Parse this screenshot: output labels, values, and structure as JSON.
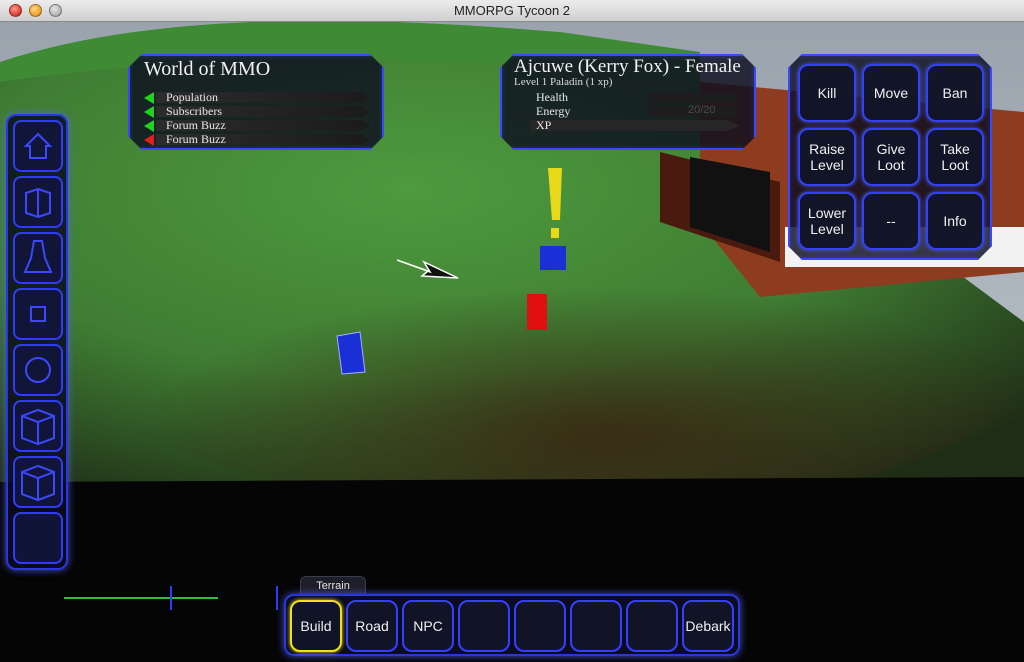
{
  "window": {
    "title": "MMORPG Tycoon 2"
  },
  "world_panel": {
    "title": "World of MMO",
    "stats": [
      {
        "label": "Population",
        "trend": "up",
        "color": "#1fd41f"
      },
      {
        "label": "Subscribers",
        "trend": "up",
        "color": "#1fd41f"
      },
      {
        "label": "Forum Buzz",
        "trend": "up",
        "color": "#1fd41f"
      },
      {
        "label": "Forum Buzz",
        "trend": "down",
        "color": "#e02020"
      }
    ]
  },
  "character_panel": {
    "name": "Ajcuwe (Kerry Fox) - Female",
    "subtitle": "Level 1 Paladin (1 xp)",
    "stats": [
      {
        "label": "Health",
        "value": ""
      },
      {
        "label": "Energy",
        "value": "20/20"
      },
      {
        "label": "XP",
        "value": ""
      }
    ]
  },
  "admin_panel": {
    "buttons": [
      "Kill",
      "Move",
      "Ban",
      "Raise\nLevel",
      "Give\nLoot",
      "Take\nLoot",
      "Lower\nLevel",
      "--",
      "Info"
    ]
  },
  "left_toolbar": {
    "tools": [
      "house-icon",
      "book-icon",
      "bell-icon",
      "square-icon",
      "circle-icon",
      "box-icon",
      "box-icon",
      "empty"
    ]
  },
  "bottom_bar": {
    "tab_label": "Terrain",
    "buttons": [
      "Build",
      "Road",
      "NPC",
      "",
      "",
      "",
      "",
      "Debark"
    ],
    "selected": "Build"
  },
  "colors": {
    "accent": "#3340ff",
    "selected": "#f0e020"
  }
}
